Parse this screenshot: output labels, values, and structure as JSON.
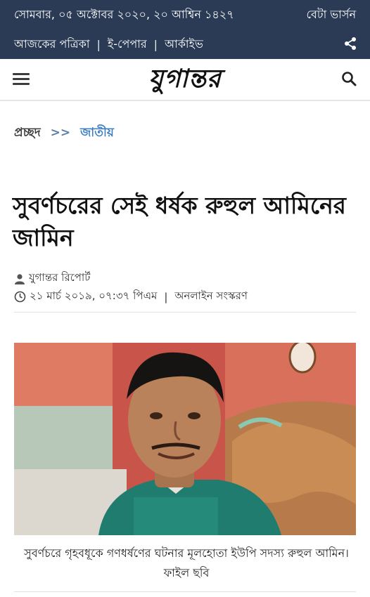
{
  "topbar": {
    "date": "সোমবার, ০৫ অক্টোবর ২০২০, ২০ আশ্বিন ১৪২৭",
    "beta_version": "বেটা ভার্সন",
    "nav": [
      "আজকের পত্রিকা",
      "ই-পেপার",
      "আর্কাইভ"
    ],
    "share_icon": "share-icon",
    "background": "#2b3b55"
  },
  "header": {
    "logo": "যুগান্তর",
    "menu_icon": "hamburger-icon",
    "search_icon": "search-icon"
  },
  "breadcrumb": {
    "home": "প্রচ্ছদ",
    "separator": ">>",
    "category": "জাতীয়",
    "category_color": "#3a7cc0"
  },
  "article": {
    "title": "সুবর্ণচরের সেই ধর্ষক রুহুল আমিনের জামিন",
    "author": "যুগান্তর রিপোর্ট",
    "datetime": "২১ মার্চ ২০১৯, ০৭:৩৭ পিএম",
    "edition": "অনলাইন সংস্করণ",
    "image_caption": "সুবর্ণচরে গৃহবধূকে গণধর্ষণের ঘটনার মূলহোতা ইউপি সদস্য রুহুল আমিন। ফাইল ছবি"
  }
}
